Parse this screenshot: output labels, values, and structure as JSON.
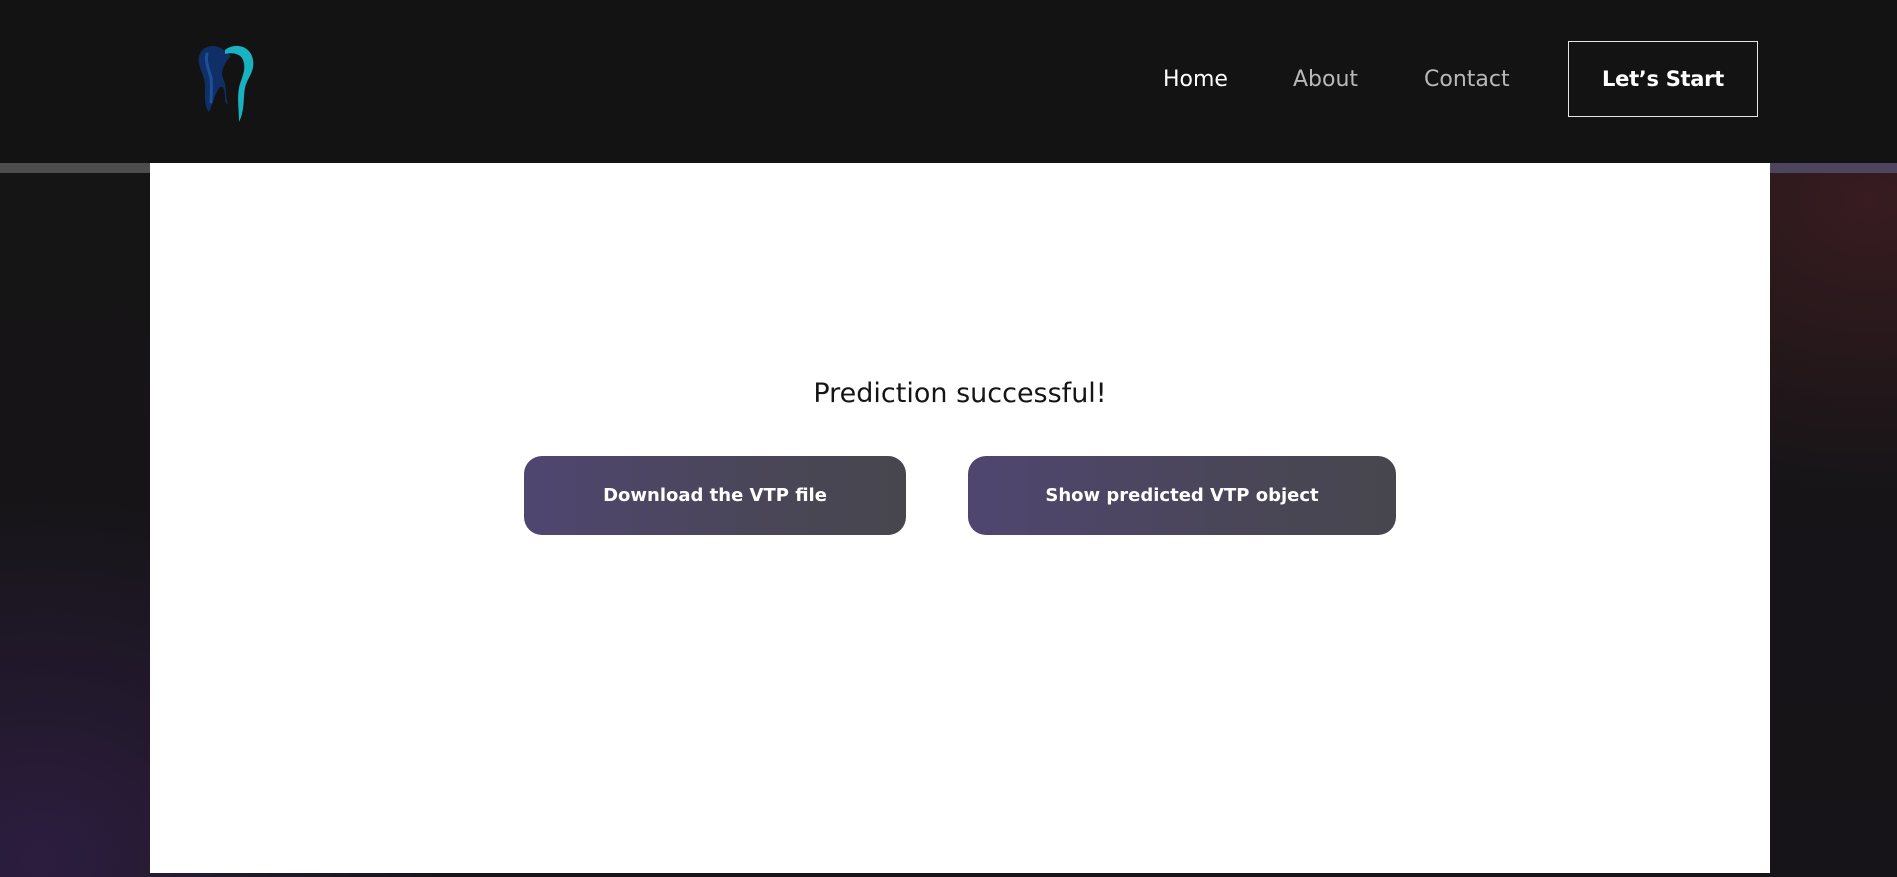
{
  "header": {
    "logo_icon": "tooth-icon",
    "nav": {
      "home": "Home",
      "about": "About",
      "contact": "Contact"
    },
    "cta_label": "Let’s Start"
  },
  "main": {
    "status_text": "Prediction successful!",
    "download_label": "Download the VTP file",
    "show_label": "Show predicted VTP object"
  },
  "colors": {
    "header_bg": "#131313",
    "card_bg": "#ffffff",
    "button_gradient_start": "#4f4670",
    "button_gradient_end": "#47464d",
    "logo_dark": "#153a78",
    "logo_teal": "#1bb3c2"
  }
}
